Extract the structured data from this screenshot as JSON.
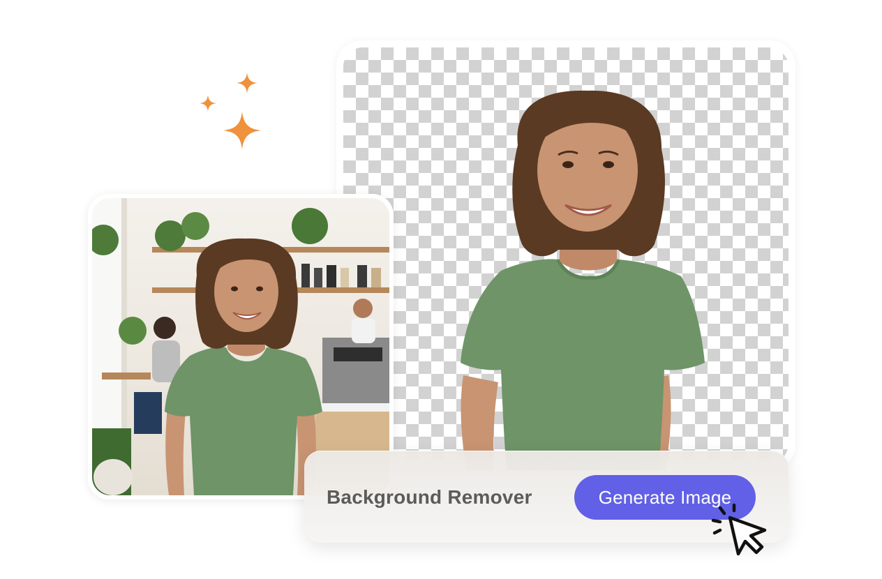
{
  "action_bar": {
    "title": "Background Remover",
    "button_label": "Generate Image"
  },
  "icons": {
    "sparkles": "sparkle-icon",
    "cursor": "pointer-cursor-icon"
  },
  "colors": {
    "accent": "#6160e6",
    "sparkle": "#f0913c",
    "shirt": "#6e9468",
    "hair": "#5a3a22",
    "skin": "#c89472",
    "title_text": "#5b5b5b"
  }
}
